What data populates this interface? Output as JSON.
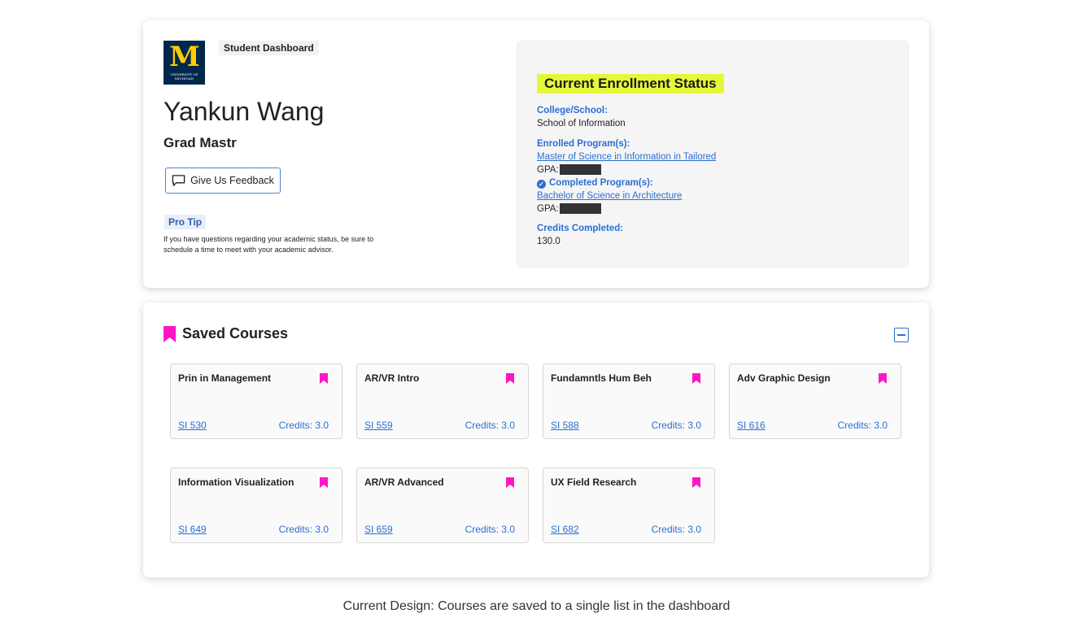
{
  "header": {
    "logo_main": "M",
    "logo_sub_line1": "UNIVERSITY OF",
    "logo_sub_line2": "MICHIGAN",
    "dashboard_chip": "Student Dashboard",
    "student_name": "Yankun Wang",
    "program": "Grad Mastr",
    "feedback_label": "Give Us Feedback",
    "pro_tip_label": "Pro Tip",
    "pro_tip_text": "If you have questions regarding your academic status, be sure to schedule a time to meet with your academic advisor."
  },
  "status": {
    "title": "Current Enrollment Status",
    "college_label": "College/School:",
    "college_value": "School of Information",
    "enrolled_label": "Enrolled Program(s):",
    "enrolled_value": "Master of Science in Information in Tailored",
    "gpa_label": "GPA:",
    "completed_label": "Completed Program(s):",
    "completed_value": "Bachelor of Science in Architecture",
    "credits_label": "Credits Completed:",
    "credits_value": "130.0"
  },
  "saved": {
    "title": "Saved Courses",
    "accent": "#ff16c6",
    "courses": [
      {
        "name": "Prin in Management",
        "code": "SI 530",
        "credits": "Credits: 3.0"
      },
      {
        "name": "AR/VR Intro",
        "code": "SI 559",
        "credits": "Credits: 3.0"
      },
      {
        "name": "Fundamntls Hum Beh",
        "code": "SI 588",
        "credits": "Credits: 3.0"
      },
      {
        "name": "Adv Graphic Design",
        "code": "SI 616",
        "credits": "Credits: 3.0"
      },
      {
        "name": "Information Visualization",
        "code": "SI 649",
        "credits": "Credits: 3.0"
      },
      {
        "name": "AR/VR Advanced",
        "code": "SI 659",
        "credits": "Credits: 3.0"
      },
      {
        "name": "UX Field Research",
        "code": "SI 682",
        "credits": "Credits: 3.0"
      }
    ]
  },
  "caption": "Current Design: Courses are saved to a single list in the dashboard"
}
